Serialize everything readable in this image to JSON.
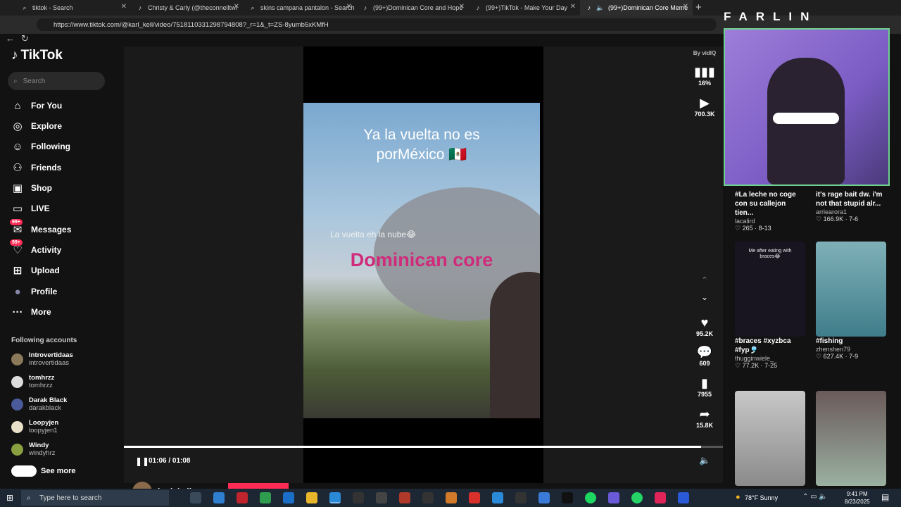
{
  "browser": {
    "tabs": [
      {
        "title": "tiktok - Search",
        "icon": "search-icon"
      },
      {
        "title": "Christy & Carly (@theconnelltwi",
        "icon": "tiktok-icon"
      },
      {
        "title": "skins campana pantalon - Search",
        "icon": "search-icon"
      },
      {
        "title": "(99+)Dominican Core and Hope",
        "icon": "tiktok-icon"
      },
      {
        "title": "(99+)TikTok - Make Your Day",
        "icon": "tiktok-icon"
      },
      {
        "title": "(99+)Dominican Core Meme",
        "icon": "tiktok-icon"
      }
    ],
    "url": "https://www.tiktok.com/@karl_kell/video/7518110331298794808?_r=1&_t=ZS-8yumb5xKMfH"
  },
  "sidebar": {
    "logo": "TikTok",
    "search_placeholder": "Search",
    "nav": [
      {
        "label": "For You",
        "icon": "home-icon"
      },
      {
        "label": "Explore",
        "icon": "compass-icon"
      },
      {
        "label": "Following",
        "icon": "following-icon"
      },
      {
        "label": "Friends",
        "icon": "friends-icon"
      },
      {
        "label": "Shop",
        "icon": "shop-icon"
      },
      {
        "label": "LIVE",
        "icon": "live-icon"
      },
      {
        "label": "Messages",
        "icon": "messages-icon",
        "badge": "99+"
      },
      {
        "label": "Activity",
        "icon": "activity-icon",
        "badge": "99+"
      },
      {
        "label": "Upload",
        "icon": "upload-icon"
      },
      {
        "label": "Profile",
        "icon": "profile-icon"
      },
      {
        "label": "More",
        "icon": "more-icon"
      }
    ],
    "following_title": "Following accounts",
    "accounts": [
      {
        "name": "Introvertidaas",
        "handle": "introvertidaas"
      },
      {
        "name": "tomhrzz",
        "handle": "tomhrzz"
      },
      {
        "name": "Darak Black",
        "handle": "darakblack"
      },
      {
        "name": "Loopyjen",
        "handle": "loopyjen1"
      },
      {
        "name": "Windy",
        "handle": "windyhrz"
      }
    ],
    "see_more": "See more"
  },
  "video": {
    "caption_top": "Ya la vuelta no es porMéxico 🇲🇽",
    "caption_mid": "La vuelta eh la nube😂",
    "caption_main": "Dominican core",
    "time": "01:06 / 01:08",
    "progress": 0.963,
    "author": "karl_kell"
  },
  "actions": {
    "vidiq": "By vidIQ",
    "score": "16%",
    "views": "700.3K",
    "likes": "95.2K",
    "comments": "609",
    "saves": "7955",
    "shares": "15.8K"
  },
  "overlay": {
    "streamer_name": "FARLIN"
  },
  "cards": [
    {
      "title": "#La leche no coge con su callejon tien...",
      "author": "lacalird",
      "stats": "♡ 265 · 8-13"
    },
    {
      "title": "it's rage bait dw. i'm not that stupid alr...",
      "author": "arriearora1",
      "stats": "♡ 166.9K · 7-6"
    },
    {
      "title": "#braces #xyzbca #fyp🎐",
      "author": "thugginwiele_",
      "stats": "♡ 77.2K · 7-25",
      "thumb_text": "Me after eating with braces😂"
    },
    {
      "title": "#fishing",
      "author": "zhenshen79",
      "stats": "♡ 627.4K · 7-9"
    }
  ],
  "taskbar": {
    "search_placeholder": "Type here to search",
    "weather": "78°F  Sunny",
    "time": "9:41 PM",
    "date": "8/23/2025"
  },
  "colors": {
    "accent": "#fe2c55",
    "background": "#121212"
  }
}
